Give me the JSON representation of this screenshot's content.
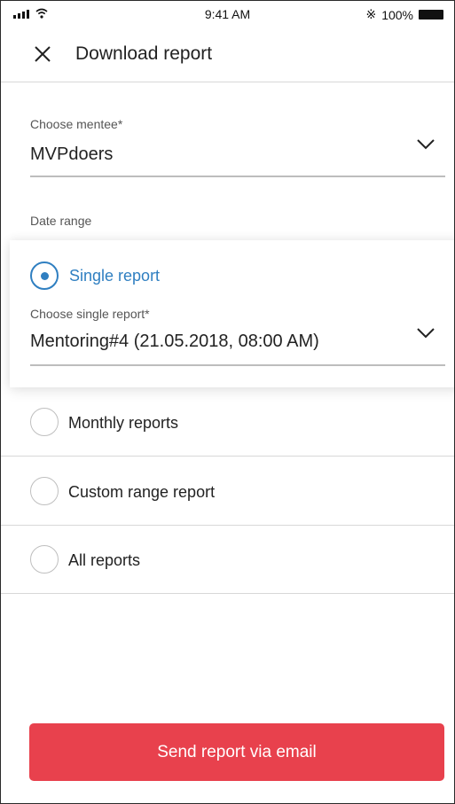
{
  "status_bar": {
    "time": "9:41 AM",
    "battery": "100%",
    "bluetooth_icon": "bluetooth-icon",
    "signal_icon": "signal-icon",
    "wifi_icon": "wifi-icon"
  },
  "header": {
    "title": "Download report",
    "close_icon": "close-icon"
  },
  "mentee": {
    "label": "Choose mentee*",
    "value": "MVPdoers"
  },
  "date_range": {
    "label": "Date range",
    "options": [
      {
        "label": "Single report",
        "selected": true
      },
      {
        "label": "Monthly reports",
        "selected": false
      },
      {
        "label": "Custom range report",
        "selected": false
      },
      {
        "label": "All reports",
        "selected": false
      }
    ]
  },
  "single_report": {
    "label": "Choose single report*",
    "value": "Mentoring#4 (21.05.2018, 08:00 AM)"
  },
  "actions": {
    "send_label": "Send report via email"
  },
  "colors": {
    "accent": "#2f7fc1",
    "primary_button": "#e8414d"
  }
}
